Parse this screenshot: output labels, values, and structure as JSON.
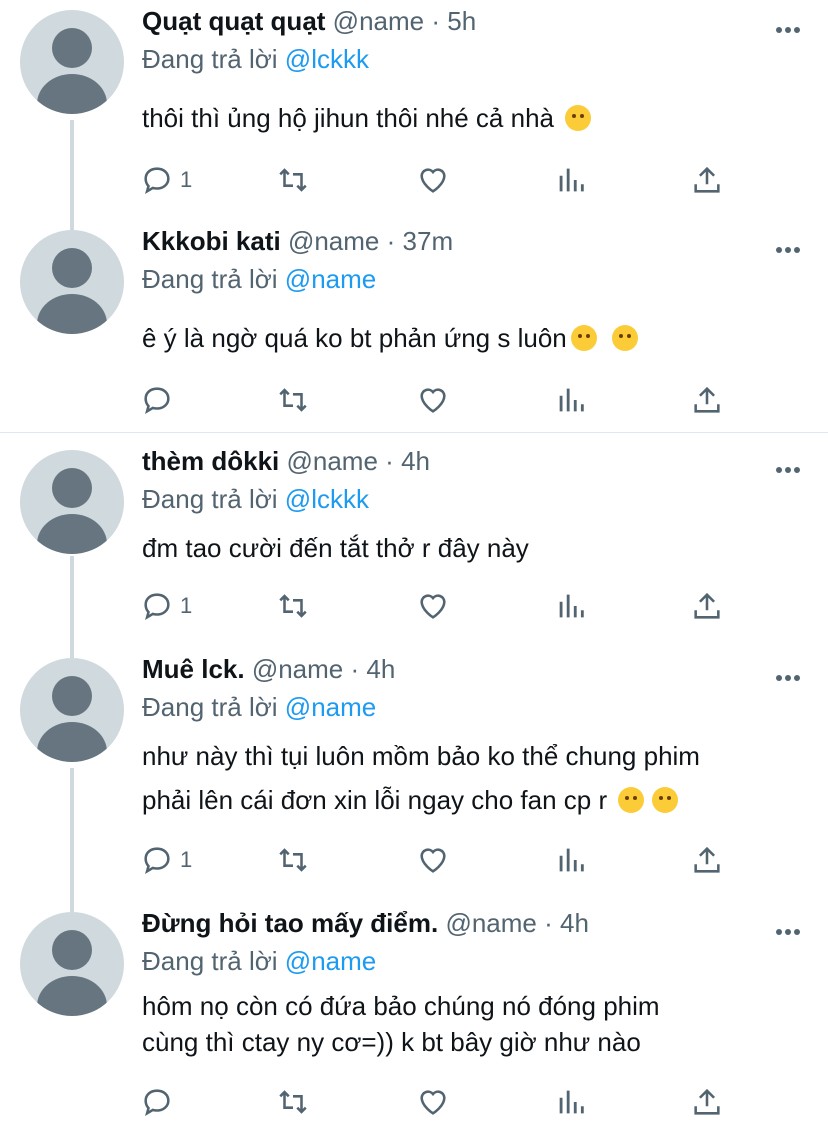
{
  "tweets": [
    {
      "name": "Quạt quạt quạt",
      "handle": "@name",
      "dot": "·",
      "time": "5h",
      "reply_label": "Đang trả lời",
      "reply_to": "@lckkk",
      "lines": [
        "thôi thì ủng hộ jihun thôi nhé cả nhà"
      ],
      "reply_count": "1"
    },
    {
      "name": "Kkkobi kati",
      "handle": "@name",
      "dot": "·",
      "time": "37m",
      "reply_label": "Đang trả lời",
      "reply_to": "@name",
      "lines": [
        "ê ý là ngờ quá ko bt phản ứng s luôn"
      ],
      "reply_count": ""
    },
    {
      "name": "thèm dôkki",
      "handle": "@name",
      "dot": "·",
      "time": "4h",
      "reply_label": "Đang trả lời",
      "reply_to": "@lckkk",
      "lines": [
        "đm tao cười đến tắt thở r đây này"
      ],
      "reply_count": "1"
    },
    {
      "name": "Muê lck.",
      "handle": "@name",
      "dot": "·",
      "time": "4h",
      "reply_label": "Đang trả lời",
      "reply_to": "@name",
      "lines": [
        "như này thì tụi luôn mồm bảo ko thể chung phim",
        "phải lên cái đơn xin lỗi ngay cho fan cp r"
      ],
      "reply_count": "1"
    },
    {
      "name": "Đừng hỏi tao mấy điểm.",
      "handle": "@name",
      "dot": "·",
      "time": "4h",
      "reply_label": "Đang trả lời",
      "reply_to": "@name",
      "lines": [
        "hôm nọ còn có đứa bảo chúng nó đóng phim",
        "cùng thì ctay ny cơ=)) k bt bây giờ như nào"
      ],
      "reply_count": ""
    }
  ],
  "icons": {
    "reply": "reply-icon",
    "retweet": "retweet-icon",
    "like": "heart-icon",
    "views": "views-icon",
    "share": "share-icon",
    "more": "more-icon",
    "emoji": "emoji-icon"
  },
  "colors": {
    "mention": "#1d9bf0",
    "secondary": "#536471",
    "thread_line": "#cfd9de"
  }
}
